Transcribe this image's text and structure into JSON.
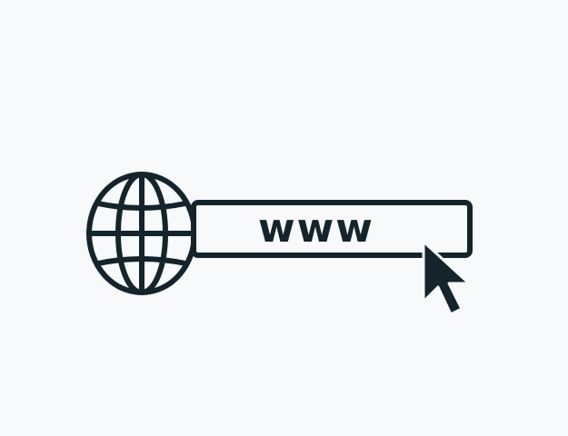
{
  "address_bar": {
    "text": "www"
  },
  "icons": {
    "globe": "globe-icon",
    "cursor": "mouse-pointer-icon"
  },
  "colors": {
    "background": "#f7f9fb",
    "ink": "#15242b"
  }
}
